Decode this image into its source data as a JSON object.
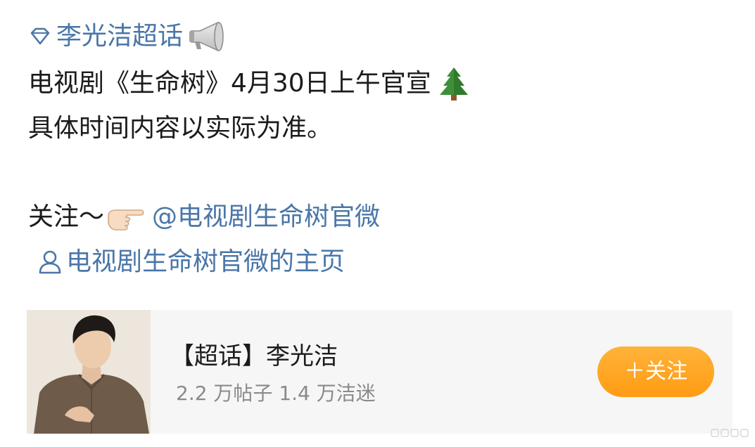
{
  "post": {
    "supertopic_link": "李光洁超话",
    "line1": "电视剧《生命树》4月30日上午官宣",
    "line2": "具体时间内容以实际为准。",
    "follow_prefix": "关注～",
    "mention_link": "@电视剧生命树官微",
    "homepage_link": "电视剧生命树官微的主页"
  },
  "card": {
    "title": "【超话】李光洁",
    "stats": "2.2 万帖子 1.4 万洁迷",
    "follow_button": "＋关注"
  },
  "colors": {
    "link": "#4a76a8",
    "text": "#1b1b1b",
    "muted": "#8a8a8a",
    "card_bg": "#f6f6f6",
    "button": "#ff9b13"
  },
  "icons": {
    "supertopic": "diamond-icon",
    "announce": "megaphone-icon",
    "tree": "evergreen-tree-icon",
    "pointing": "pointing-hand-icon",
    "profile": "user-icon"
  }
}
